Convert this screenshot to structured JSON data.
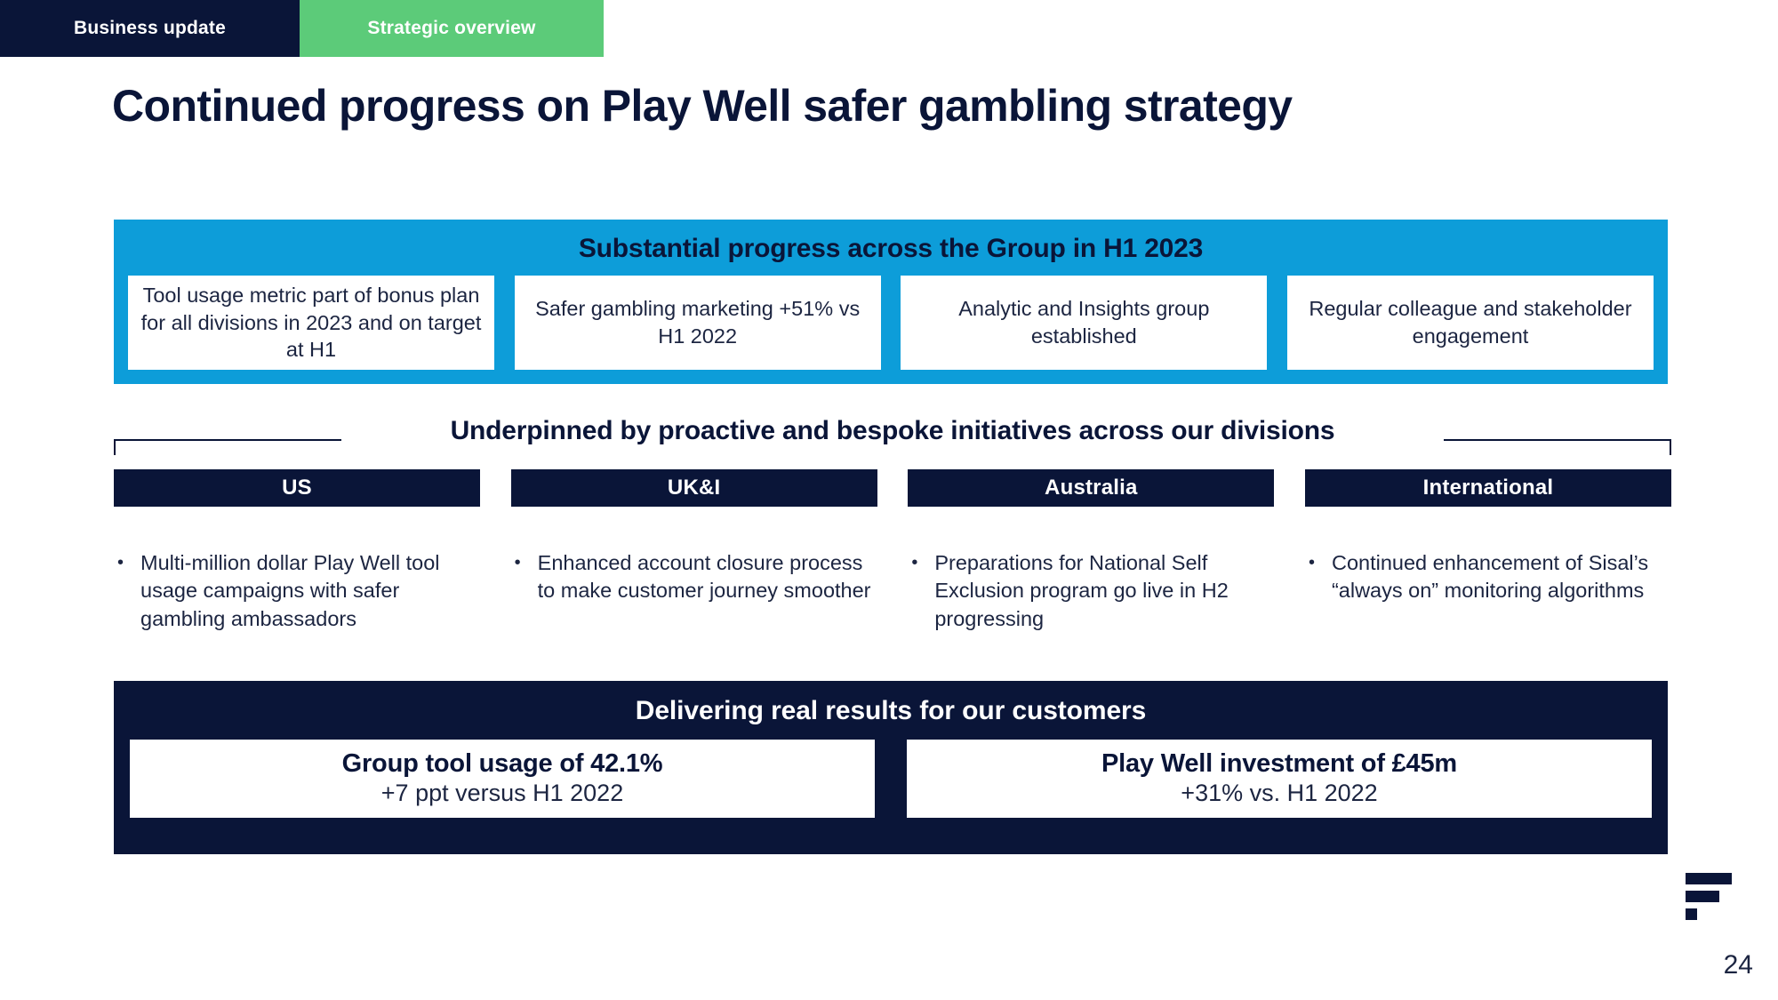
{
  "header": {
    "tabs": [
      {
        "label": "Business update",
        "active": false,
        "color": "#0A1538"
      },
      {
        "label": "Strategic overview",
        "active": true,
        "color": "#5CCB79"
      }
    ]
  },
  "title": "Continued progress on Play Well safer gambling strategy",
  "banner": {
    "heading": "Substantial progress across the Group in H1 2023",
    "background": "#0D9DD9",
    "cards": [
      "Tool usage metric part of bonus plan for all divisions in 2023 and on target at H1",
      "Safer gambling marketing +51% vs H1 2022",
      "Analytic and Insights group established",
      "Regular colleague and stakeholder engagement"
    ]
  },
  "underpinned": {
    "heading": "Underpinned by proactive and bespoke initiatives across our divisions"
  },
  "divisions": [
    {
      "name": "US",
      "bullets": [
        "Multi-million dollar Play Well tool usage campaigns with safer gambling ambassadors"
      ]
    },
    {
      "name": "UK&I",
      "bullets": [
        "Enhanced account closure process to make customer journey smoother"
      ]
    },
    {
      "name": "Australia",
      "bullets": [
        "Preparations for National Self Exclusion program go live in H2 progressing"
      ]
    },
    {
      "name": "International",
      "bullets": [
        "Continued enhancement of Sisal’s “always on” monitoring algorithms"
      ]
    }
  ],
  "results": {
    "heading": "Delivering real results for our customers",
    "background": "#0A1538",
    "cards": [
      {
        "headline": "Group tool usage of 42.1%",
        "sub": "+7 ppt versus H1 2022"
      },
      {
        "headline": "Play Well investment of £45m",
        "sub": "+31% vs. H1 2022"
      }
    ]
  },
  "footer": {
    "page_number": "24",
    "logo": "flutter-f-logo"
  },
  "bullet_glyph": "•"
}
